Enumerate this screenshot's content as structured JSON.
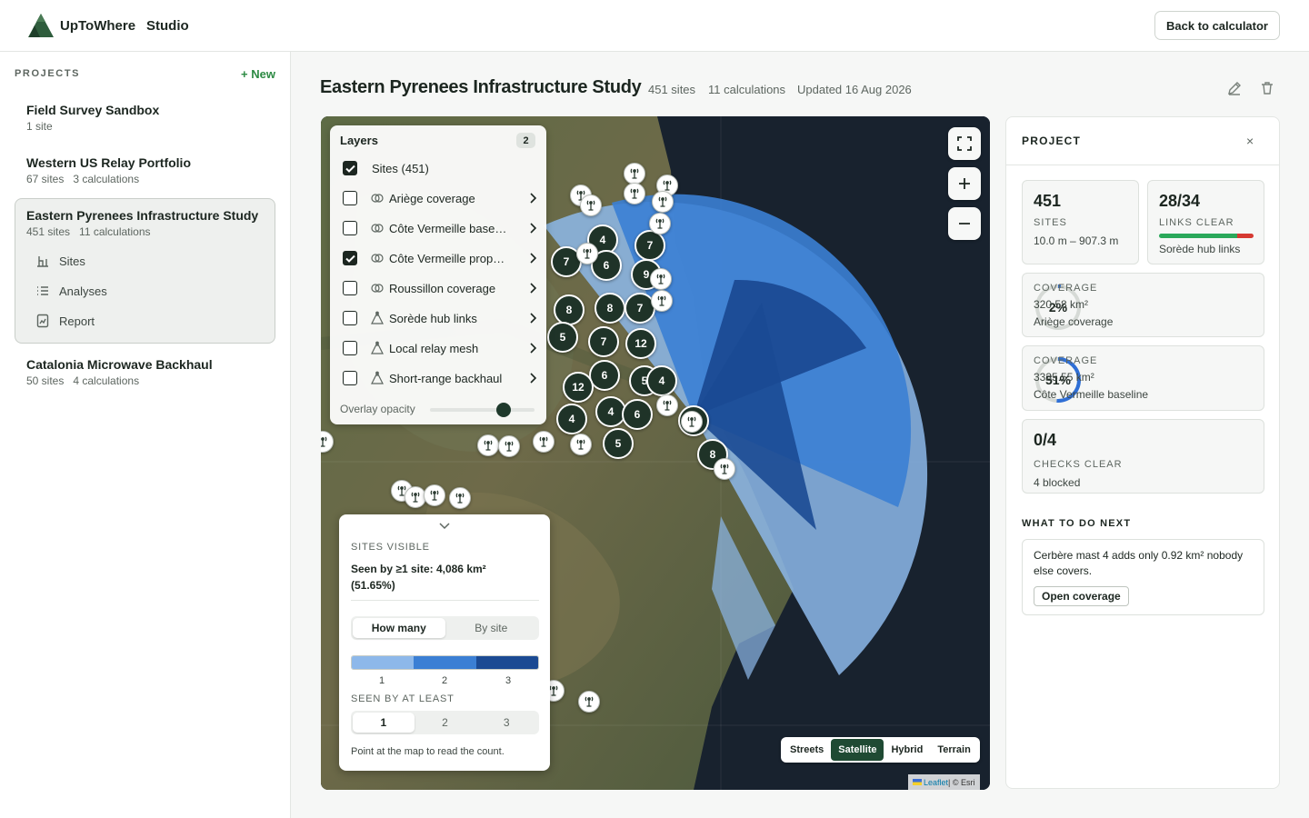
{
  "app": {
    "brand": "UpToWhere",
    "section": "Studio",
    "back_label": "Back to calculator"
  },
  "sidebar": {
    "heading": "PROJECTS",
    "new_label": "+ New",
    "projects": [
      {
        "name": "Field Survey Sandbox",
        "sites": "1 site",
        "calcs": ""
      },
      {
        "name": "Western US Relay Portfolio",
        "sites": "67 sites",
        "calcs": "3 calculations"
      },
      {
        "name": "Eastern Pyrenees Infrastructure Study",
        "sites": "451 sites",
        "calcs": "11 calculations"
      },
      {
        "name": "Catalonia Microwave Backhaul",
        "sites": "50 sites",
        "calcs": "4 calculations"
      }
    ],
    "subnav": [
      "Sites",
      "Analyses",
      "Report"
    ]
  },
  "header": {
    "title": "Eastern Pyrenees Infrastructure Study",
    "sites": "451 sites",
    "calcs": "11 calculations",
    "updated": "Updated 16 Aug 2026",
    "edit_icon": "pencil-icon",
    "delete_icon": "trash-icon"
  },
  "layers": {
    "title": "Layers",
    "count": "2",
    "items": [
      {
        "label": "Sites (451)",
        "checked": true,
        "icon": "none"
      },
      {
        "label": "Ariège coverage",
        "checked": false,
        "icon": "coverage-icon"
      },
      {
        "label": "Côte Vermeille baseline",
        "checked": false,
        "icon": "coverage-icon"
      },
      {
        "label": "Côte Vermeille proposed",
        "checked": true,
        "icon": "coverage-icon"
      },
      {
        "label": "Roussillon coverage",
        "checked": false,
        "icon": "coverage-icon"
      },
      {
        "label": "Sorède hub links",
        "checked": false,
        "icon": "links-icon"
      },
      {
        "label": "Local relay mesh",
        "checked": false,
        "icon": "links-icon"
      },
      {
        "label": "Short-range backhaul",
        "checked": false,
        "icon": "links-icon"
      }
    ],
    "opacity_label": "Overlay opacity",
    "opacity": 0.7
  },
  "map": {
    "clusters": [
      "4",
      "7",
      "7",
      "6",
      "9",
      "8",
      "8",
      "7",
      "5",
      "7",
      "12",
      "6",
      "5",
      "4",
      "12",
      "4",
      "4",
      "6",
      "5",
      "6",
      "8"
    ],
    "basemaps": [
      "Streets",
      "Satellite",
      "Hybrid",
      "Terrain"
    ],
    "active_basemap": "Satellite",
    "attribution_link": "Leaflet",
    "attribution_rest": " | © Esri"
  },
  "sites_card": {
    "label": "SITES VISIBLE",
    "summary": "Seen by ≥1 site: 4,086 km² (51.65%)",
    "mode_tabs": [
      "How many",
      "By site"
    ],
    "ramp": [
      "1",
      "2",
      "3"
    ],
    "ramp_colors": [
      "#8db8ea",
      "#3b7fd4",
      "#1b4a93"
    ],
    "seen_label": "SEEN BY AT LEAST",
    "seen_options": [
      "1",
      "2",
      "3"
    ],
    "hint": "Point at the map to read the count."
  },
  "panel": {
    "title": "PROJECT",
    "close": "×",
    "sites": {
      "value": "451",
      "caption": "SITES",
      "sub": "10.0 m – 907.3 m"
    },
    "links": {
      "value": "28/34",
      "caption": "LINKS CLEAR",
      "sub": "Sorède hub links",
      "clear": 28,
      "total": 34,
      "colors": [
        "#2aa85a",
        "#d63a32"
      ]
    },
    "coverage": [
      {
        "pct": "2%",
        "fraction": 0.02,
        "caption": "COVERAGE",
        "area": "320.58 km²",
        "name": "Ariège coverage"
      },
      {
        "pct": "51%",
        "fraction": 0.51,
        "caption": "COVERAGE",
        "area": "3335.55 km²",
        "name": "Côte Vermeille baseline"
      }
    ],
    "checks": {
      "value": "0/4",
      "caption": "CHECKS CLEAR",
      "sub": "4 blocked"
    },
    "next_title": "WHAT TO DO NEXT",
    "next_text": "Cerbère mast 4 adds only 0.92 km² nobody else covers.",
    "next_button": "Open coverage",
    "accent": "#2f6fd6"
  }
}
